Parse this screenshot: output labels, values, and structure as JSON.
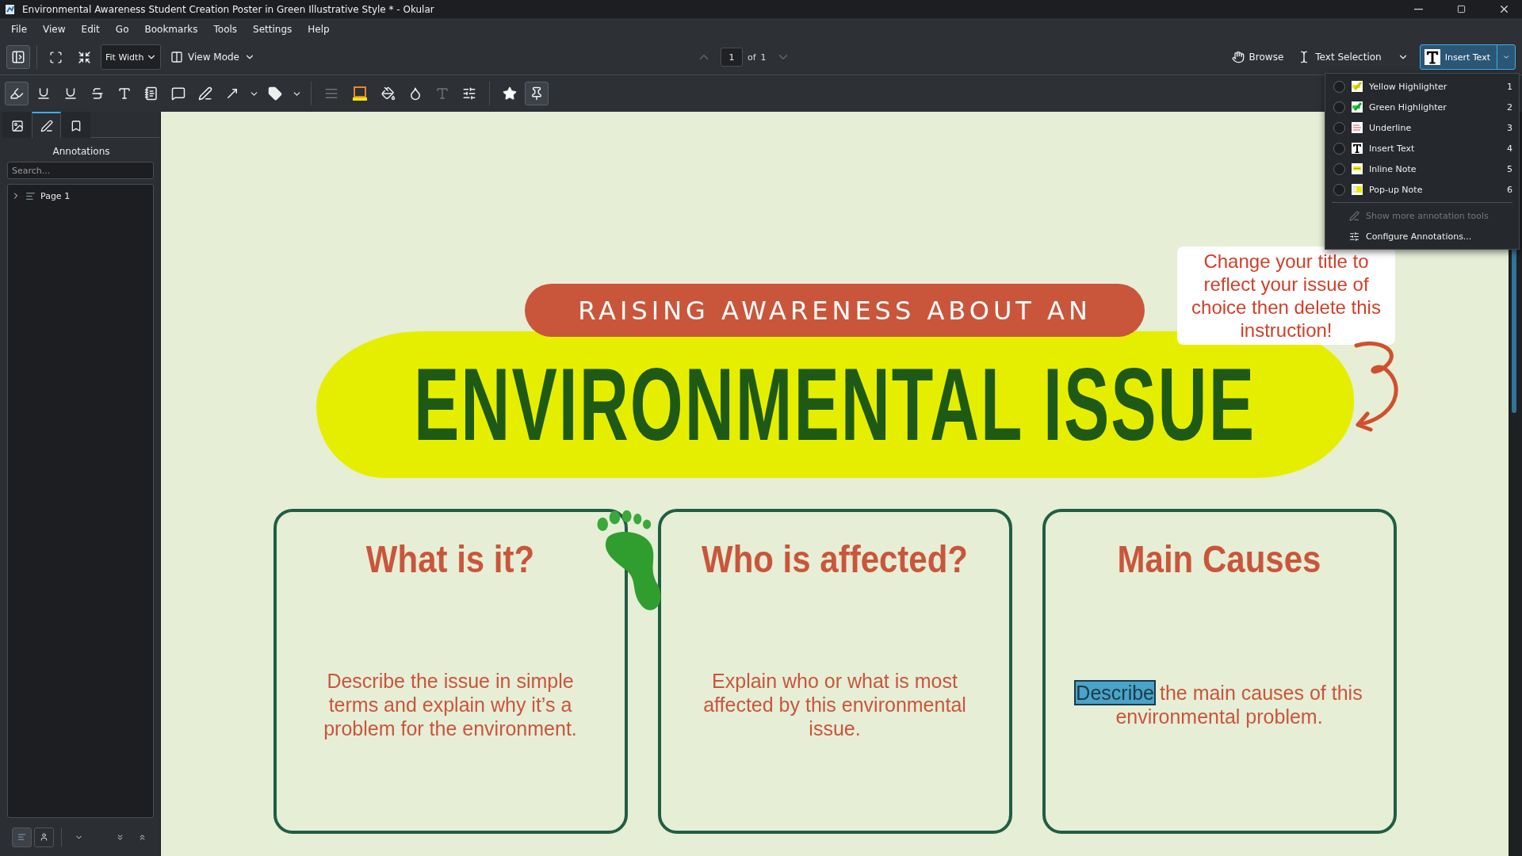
{
  "window": {
    "title": "Environmental Awareness Student Creation Poster in Green Illustrative Style * - Okular"
  },
  "menu_bar": [
    "File",
    "View",
    "Edit",
    "Go",
    "Bookmarks",
    "Tools",
    "Settings",
    "Help"
  ],
  "toolbar": {
    "zoom": "Fit Width",
    "view_mode": "View Mode",
    "page": "1",
    "page_of": "of",
    "page_total": "1",
    "browse": "Browse",
    "text_selection": "Text Selection",
    "insert_text": "Insert Text",
    "insert_text_selected": true
  },
  "annotation_toolbar": [
    [
      {
        "kind": "highlighter",
        "selected": true
      },
      {
        "kind": "underline",
        "selected": false
      },
      {
        "kind": "squiggle",
        "selected": false
      },
      {
        "kind": "strikeout",
        "selected": false
      },
      {
        "kind": "typewriter",
        "selected": false
      },
      {
        "kind": "inline-note",
        "selected": false
      },
      {
        "kind": "popup-note",
        "selected": false
      },
      {
        "kind": "freehand",
        "selected": false
      },
      {
        "kind": "line",
        "selected": false,
        "has_menu": true
      },
      {
        "kind": "stamp",
        "selected": false,
        "has_menu": true
      }
    ],
    [
      {
        "kind": "line-width",
        "selected": false,
        "disabled": true
      },
      {
        "kind": "color",
        "selected": false,
        "disabled": false
      },
      {
        "kind": "fill",
        "selected": false,
        "disabled": false
      },
      {
        "kind": "opacity",
        "selected": false,
        "disabled": false
      },
      {
        "kind": "font",
        "selected": false,
        "disabled": true
      },
      {
        "kind": "settings",
        "selected": false,
        "disabled": false
      }
    ],
    [
      {
        "kind": "favorite",
        "selected": false
      },
      {
        "kind": "pin",
        "selected": true
      }
    ]
  ],
  "sidebar": {
    "tabs": [
      {
        "kind": "thumbnails",
        "selected": false
      },
      {
        "kind": "annotations",
        "selected": true
      },
      {
        "kind": "bookmarks",
        "selected": false
      }
    ],
    "title": "Annotations",
    "search": {
      "placeholder": "Search..."
    },
    "tree": [
      {
        "label": "Page 1",
        "expanded": false
      }
    ],
    "bottom_buttons": [
      {
        "kind": "group-by-page",
        "selected": true
      },
      {
        "kind": "group-by-author",
        "selected": false
      }
    ]
  },
  "annotation_menu": {
    "items": [
      {
        "label": "Yellow Highlighter",
        "shortcut": "1",
        "kind": "yellow-highlighter",
        "checked": false
      },
      {
        "label": "Green Highlighter",
        "shortcut": "2",
        "kind": "green-highlighter",
        "checked": false
      },
      {
        "label": "Underline",
        "shortcut": "3",
        "kind": "underline",
        "checked": false
      },
      {
        "label": "Insert Text",
        "shortcut": "4",
        "kind": "insert-text",
        "checked": false
      },
      {
        "label": "Inline Note",
        "shortcut": "5",
        "kind": "inline-note",
        "checked": false
      },
      {
        "label": "Pop-up Note",
        "shortcut": "6",
        "kind": "popup-note",
        "checked": false
      }
    ],
    "actions": [
      {
        "label": "Show more annotation tools",
        "kind": "more",
        "disabled": true
      },
      {
        "label": "Configure Annotations...",
        "kind": "configure",
        "disabled": false
      }
    ]
  },
  "poster": {
    "banner": "RAISING AWARENESS ABOUT AN",
    "title": "ENVIRONMENTAL ISSUE",
    "note": "Change your title to reflect your issue of choice then delete this instruction!",
    "cards": [
      {
        "title": "What is it?",
        "body": [
          {
            "text": "Describe the issue in simple terms and explain why it’s a problem for the environment.",
            "highlighted": false
          }
        ]
      },
      {
        "title": "Who is affected?",
        "body": [
          {
            "text": "Explain who or what is most affected by this environmental issue.",
            "highlighted": false
          }
        ]
      },
      {
        "title": "Main Causes",
        "body": [
          {
            "text": "Describe",
            "highlighted": true
          },
          {
            "text": " the main causes of this environmental problem.",
            "highlighted": false
          }
        ]
      }
    ]
  }
}
